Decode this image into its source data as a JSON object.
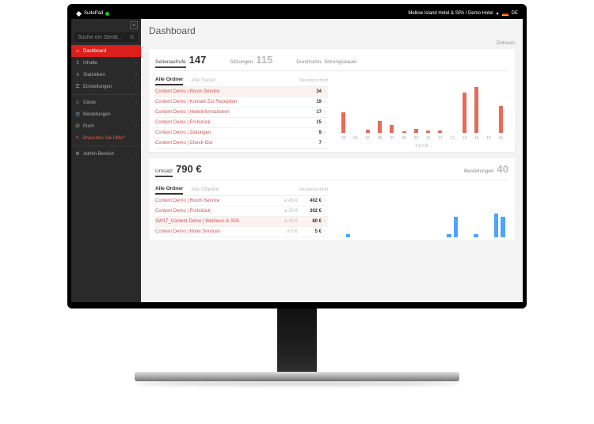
{
  "topbar": {
    "brand": "SuitePad",
    "hotel": "Mellow Island Hotel & SPA / Demo Hotel",
    "lang": "DE"
  },
  "sidebar": {
    "search_placeholder": "Suche ein Gerät...",
    "items": [
      {
        "icon": "home",
        "label": "Dashboard",
        "active": true
      },
      {
        "icon": "upload",
        "label": "Inhalte",
        "chev": true
      },
      {
        "icon": "stats",
        "label": "Statistiken",
        "chev": true
      },
      {
        "icon": "sliders",
        "label": "Einstellungen",
        "chev": true
      },
      {
        "sep": true
      },
      {
        "icon": "users",
        "label": "Gäste",
        "chev": true
      },
      {
        "icon": "cart",
        "label": "Bestellungen"
      },
      {
        "icon": "bell",
        "label": "Push",
        "chev": true
      },
      {
        "icon": "help",
        "label": "Brauchen Sie Hilfe?",
        "help": true
      },
      {
        "sep": true
      },
      {
        "icon": "admin",
        "label": "Admin Bereich",
        "chev": true
      }
    ]
  },
  "page": {
    "title": "Dashboard",
    "timerange_label": "Zeitraum"
  },
  "pageviews_card": {
    "metrics": [
      {
        "label": "Seitenaufrufe",
        "value": "147",
        "primary": true
      },
      {
        "label": "Sitzungen",
        "value": "115",
        "dim": true
      },
      {
        "label": "Durchschn. Sitzungsdauer",
        "value": "",
        "dim": true
      }
    ],
    "tabs": [
      "Alle Ordner",
      "Alle Seiten"
    ],
    "timelabel": "Stundenschnitt",
    "rows": [
      {
        "name": "Content Demo | Room Service",
        "value": "34",
        "tint": true
      },
      {
        "name": "Content Demo | Kontakt Zur Rezeption",
        "value": "19"
      },
      {
        "name": "Content Demo | Hotelinformationen",
        "value": "17"
      },
      {
        "name": "Content Demo | Frühstück",
        "value": "15"
      },
      {
        "name": "Content Demo | Zeitungen",
        "value": "9"
      },
      {
        "name": "Content Demo | Check-Out",
        "value": "7"
      }
    ],
    "chart_axis": "TAGE"
  },
  "revenue_card": {
    "metrics": [
      {
        "label": "Umsatz",
        "value": "790 €",
        "primary": true
      },
      {
        "label": "Bestellungen",
        "value": "40",
        "dim": true
      }
    ],
    "tabs": [
      "Alle Ordner",
      "Alle Objekte"
    ],
    "timelabel": "Stundenschnitt",
    "rows": [
      {
        "name": "Content Demo | Room Service",
        "sub": "ø 45 €",
        "value": "402 €"
      },
      {
        "name": "Content Demo | Frühstück",
        "sub": "ø 20 €",
        "value": "302 €"
      },
      {
        "name": "SW17_Content Demo | Wellness & SPA",
        "sub": "ø 40 €",
        "value": "80 €",
        "tint": true
      },
      {
        "name": "Content Demo | Hotel Services",
        "sub": "ø 5 €",
        "value": "5 €"
      }
    ]
  },
  "chart_data": {
    "type": "bar",
    "title": "Seitenaufrufe pro Tag",
    "xlabel": "TAGE",
    "categories": [
      "03",
      "04",
      "05",
      "06",
      "07",
      "08",
      "09",
      "10",
      "11",
      "12",
      "13",
      "14",
      "15",
      "16"
    ],
    "values": [
      30,
      0,
      5,
      18,
      12,
      2,
      6,
      4,
      3,
      0,
      60,
      68,
      0,
      40,
      26,
      0,
      0
    ],
    "ylim": [
      0,
      70
    ]
  },
  "chart_data_2": {
    "type": "bar",
    "title": "Umsatz pro Stunde",
    "values": [
      0,
      1,
      0,
      0,
      0,
      0,
      0,
      0,
      0,
      0,
      0,
      0,
      0,
      0,
      0,
      0,
      1,
      6,
      0,
      0,
      1,
      0,
      0,
      7,
      6
    ]
  },
  "colors": {
    "accent": "#dc1f1c",
    "bar_warm": "#e96a58",
    "bar_blue": "#4da3ff"
  }
}
